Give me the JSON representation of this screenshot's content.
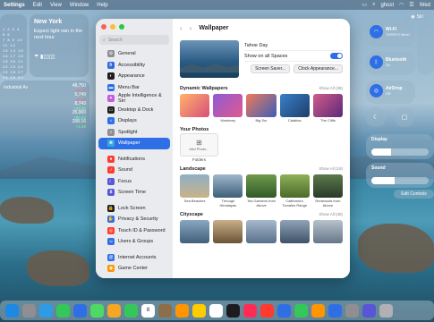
{
  "menubar": {
    "app": "Settings",
    "items": [
      "Edit",
      "View",
      "Window",
      "Help"
    ],
    "right_user": "ghost",
    "right_name": "Wed"
  },
  "calendar": {
    "rows": [
      "1 2 3 4 5 6",
      "7 8 9 10 11 12",
      "13 14 15 16 17 18",
      "19 20 21 22 23 24",
      "25 26 27 28 29 30"
    ]
  },
  "weather": {
    "city": "New York",
    "description": "Expect light rain in the next hour"
  },
  "stocks": [
    {
      "name": "Industrial Av",
      "value": "48,750",
      "change": "-48.30",
      "up": false
    },
    {
      "name": "",
      "value": "5,749",
      "change": "-30.00",
      "up": false
    },
    {
      "name": "",
      "value": "8,743",
      "change": "+28.80",
      "up": true
    },
    {
      "name": "",
      "value": "25,000",
      "change": "+50.00",
      "up": true
    },
    {
      "name": "",
      "value": "258.16",
      "change": "+1.40",
      "up": true
    }
  ],
  "sidebar": {
    "search_placeholder": "Search",
    "items": [
      {
        "label": "General",
        "icon": "gear-icon",
        "color": "#8e8e93"
      },
      {
        "label": "Accessibility",
        "icon": "accessibility-icon",
        "color": "#2f6fe6"
      },
      {
        "label": "Appearance",
        "icon": "appearance-icon",
        "color": "#1c1c1e"
      },
      {
        "label": "Menu Bar",
        "icon": "menubar-icon",
        "color": "#2f6fe6"
      },
      {
        "label": "Apple Intelligence & Siri",
        "icon": "siri-icon",
        "color": "#c45be0"
      },
      {
        "label": "Desktop & Dock",
        "icon": "dock-icon",
        "color": "#1c1c1e"
      },
      {
        "label": "Displays",
        "icon": "display-icon",
        "color": "#2f6fe6"
      },
      {
        "label": "Spotlight",
        "icon": "spotlight-icon",
        "color": "#8e8e93"
      },
      {
        "label": "Wallpaper",
        "icon": "wallpaper-icon",
        "color": "#34aadc"
      },
      {
        "label": "Notifications",
        "icon": "bell-icon",
        "color": "#ff3b30"
      },
      {
        "label": "Sound",
        "icon": "speaker-icon",
        "color": "#ff3b30"
      },
      {
        "label": "Focus",
        "icon": "moon-icon",
        "color": "#5856d6"
      },
      {
        "label": "Screen Time",
        "icon": "hourglass-icon",
        "color": "#5856d6"
      },
      {
        "label": "Lock Screen",
        "icon": "lock-icon",
        "color": "#1c1c1e"
      },
      {
        "label": "Privacy & Security",
        "icon": "hand-icon",
        "color": "#2f6fe6"
      },
      {
        "label": "Touch ID & Password",
        "icon": "fingerprint-icon",
        "color": "#ff3b30"
      },
      {
        "label": "Users & Groups",
        "icon": "users-icon",
        "color": "#2f6fe6"
      },
      {
        "label": "Internet Accounts",
        "icon": "at-icon",
        "color": "#2f6fe6"
      },
      {
        "label": "Game Center",
        "icon": "gamecenter-icon",
        "color": "#ff9500"
      }
    ],
    "active": "Wallpaper"
  },
  "main": {
    "title": "Wallpaper",
    "current_name": "Tahoe Day",
    "show_all_spaces": "Show on all Spaces",
    "screen_saver_btn": "Screen Saver...",
    "clock_btn": "Clock Appearance...",
    "dynamic": {
      "title": "Dynamic Wallpapers",
      "show_all": "Show All (38)",
      "items": [
        "",
        "Monterey",
        "Big Sur",
        "Catalina",
        "The Cliffs"
      ]
    },
    "photos": {
      "title": "Your Photos",
      "add": "Add Photo..."
    },
    "folders_label": "Folders",
    "landscape": {
      "title": "Landscape",
      "show_all": "Show All (19)",
      "items": [
        "Sea Beaches",
        "Through Himalayas",
        "Tea Gardens from Above",
        "California's Tomales Range",
        "Redwoods from Above"
      ]
    },
    "cityscape": {
      "title": "Cityscape",
      "show_all": "Show All (38)"
    }
  },
  "control_center": {
    "wifi": {
      "label": "Wi-Fi",
      "sub": "TARRYS Mesh"
    },
    "bluetooth": {
      "label": "Bluetooth",
      "sub": "On"
    },
    "airdrop": {
      "label": "AirDrop",
      "sub": "Off"
    },
    "display_label": "Display",
    "display_level": 0.35,
    "sound_label": "Sound",
    "sound_level": 0.4,
    "edit_label": "Edit Controls",
    "siri_label": "Siri"
  },
  "dock": {
    "icons": [
      "finder-icon",
      "launchpad-icon",
      "safari-icon",
      "messages-icon",
      "mail-icon",
      "maps-icon",
      "photos-icon",
      "facetime-icon",
      "calendar-icon",
      "contacts-icon",
      "reminders-icon",
      "notes-icon",
      "freeform-icon",
      "tv-icon",
      "music-icon",
      "news-icon",
      "keynote-icon",
      "numbers-icon",
      "pages-icon",
      "appstore-icon",
      "settings-icon",
      "iphone-icon",
      "trash-icon"
    ],
    "colors": [
      "#1e88e5",
      "#8e8e93",
      "#2f9be6",
      "#34c759",
      "#2f6fe6",
      "#4cd964",
      "#f5a623",
      "#34c759",
      "#ff3b30",
      "#8e6e4a",
      "#ff9500",
      "#ffcc00",
      "#ffffff",
      "#1c1c1e",
      "#ff2d55",
      "#ff3b30",
      "#2f6fe6",
      "#34c759",
      "#ff9500",
      "#2f6fe6",
      "#8e8e93",
      "#5856d6",
      "#b0b0b5"
    ],
    "calendar_day": "8"
  }
}
